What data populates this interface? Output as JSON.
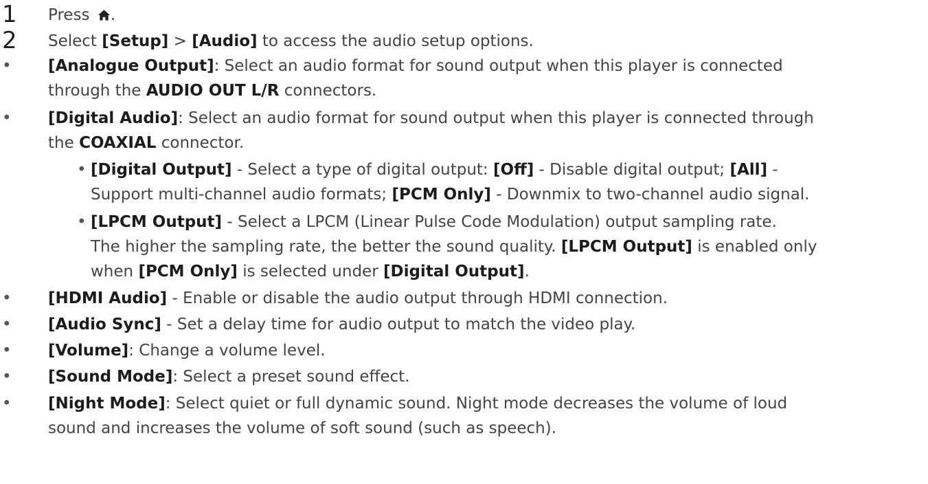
{
  "steps": [
    {
      "num": "1",
      "text": "Press ",
      "after": "."
    },
    {
      "num": "2",
      "pre": "Select ",
      "b1": "[Setup]",
      "mid": " > ",
      "b2": "[Audio]",
      "post": " to access the audio setup options."
    }
  ],
  "items": {
    "analogue": {
      "label": "[Analogue Output]",
      "line1": ": Select an audio format for sound output when this player is connected",
      "line2_pre": "through the ",
      "line2_b": "AUDIO OUT L/R",
      "line2_post": " connectors."
    },
    "digital": {
      "label": "[Digital Audio]",
      "line1": ": Select an audio format for sound output when this player is connected through",
      "line2_pre": "the ",
      "line2_b": "COAXIAL",
      "line2_post": " connector.",
      "sub": {
        "digital_output": {
          "label": "[Digital Output]",
          "t1": " - Select a type of digital output: ",
          "off": "[Off]",
          "t2": " - Disable digital output; ",
          "all": "[All]",
          "t3": " -",
          "line2_pre": "Support multi-channel audio formats; ",
          "pcm": "[PCM Only]",
          "line2_post": " - Downmix to two-channel audio signal."
        },
        "lpcm_output": {
          "label": "[LPCM Output]",
          "line1": " - Select a LPCM (Linear Pulse Code Modulation) output sampling rate.",
          "line2_pre": "The higher the sampling rate, the better the sound quality. ",
          "line2_b": "[LPCM Output]",
          "line2_post": " is enabled only",
          "line3_pre": "when ",
          "line3_b1": "[PCM Only]",
          "line3_mid": " is selected under ",
          "line3_b2": "[Digital Output]",
          "line3_post": "."
        }
      }
    },
    "hdmi": {
      "label": "[HDMI Audio]",
      "text": " - Enable or disable the audio output through HDMI connection."
    },
    "sync": {
      "label": "[Audio Sync]",
      "text": " - Set a delay time for audio output to match the video play."
    },
    "volume": {
      "label": "[Volume]",
      "text": ": Change a volume level."
    },
    "sound_mode": {
      "label": "[Sound Mode]",
      "text": ": Select a preset sound effect."
    },
    "night_mode": {
      "label": "[Night Mode]",
      "line1": ": Select quiet or full dynamic sound. Night mode decreases the volume of loud",
      "line2": "sound and increases the volume of soft sound (such as speech)."
    }
  },
  "bullet": "•",
  "icons": {
    "home": "home-icon"
  },
  "colors": {
    "text": "#444444",
    "bold": "#1c1c1c"
  }
}
